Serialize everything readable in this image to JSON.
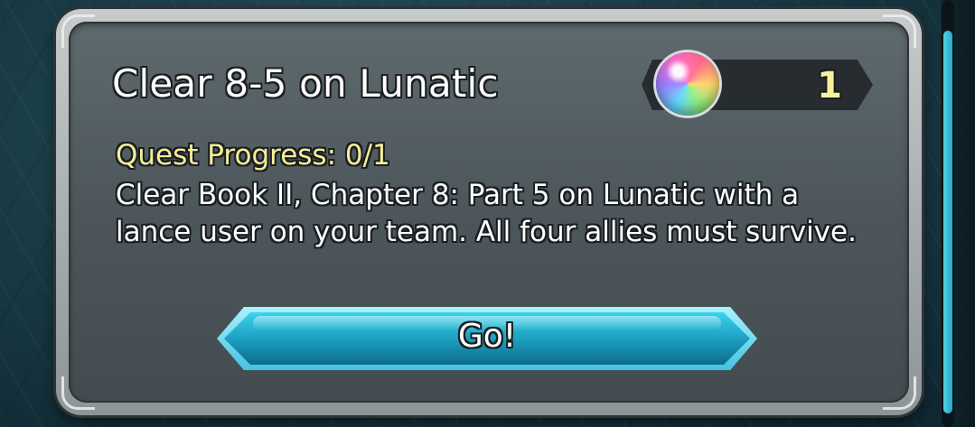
{
  "quest": {
    "title": "Clear 8-5 on Lunatic",
    "progress_text": "Quest Progress: 0/1",
    "description": "Clear Book II, Chapter 8: Part 5 on Lunatic with a lance user on your team. All four allies must survive."
  },
  "reward": {
    "icon": "orb-icon",
    "count": "1"
  },
  "go_button": {
    "label": "Go!"
  },
  "colors": {
    "panel_dark": "#4d575b",
    "title_text": "#ffffff",
    "progress_text": "#f5ee98",
    "button_accent": "#1a9bbd",
    "scrollbar": "#4fd1e6"
  }
}
